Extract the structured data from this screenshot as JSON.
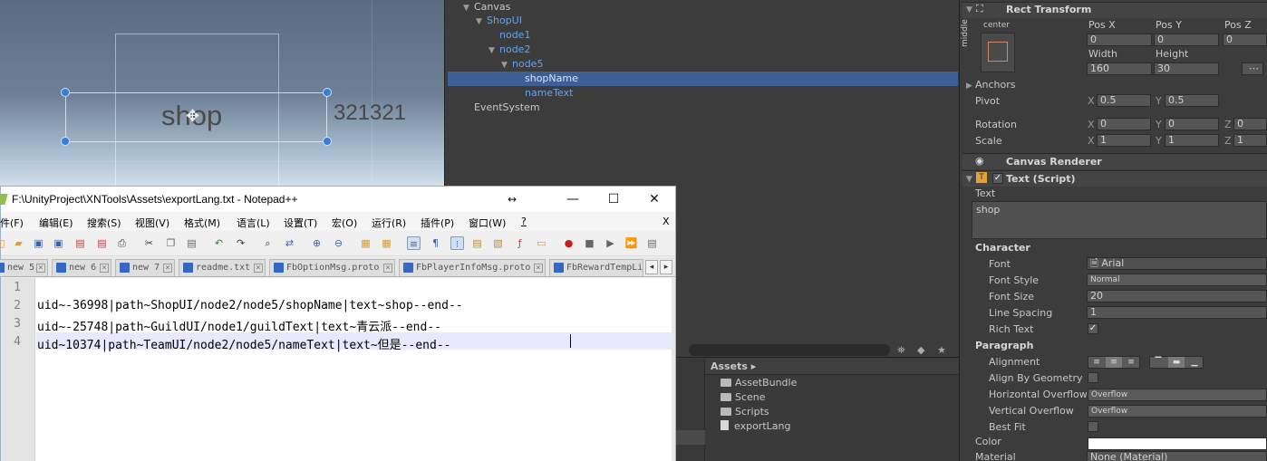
{
  "scene": {
    "shop_text": "shop",
    "number_text": "321321"
  },
  "hierarchy": {
    "items": [
      {
        "label": "Canvas",
        "expanded": true
      },
      {
        "label": "ShopUI",
        "expanded": true
      },
      {
        "label": "node1"
      },
      {
        "label": "node2",
        "expanded": true
      },
      {
        "label": "node5",
        "expanded": true
      },
      {
        "label": "shopName",
        "selected": true
      },
      {
        "label": "nameText"
      },
      {
        "label": "EventSystem"
      }
    ]
  },
  "project": {
    "header": "Assets ▸",
    "assets": [
      {
        "label": "AssetBundle",
        "type": "folder"
      },
      {
        "label": "Scene",
        "type": "folder"
      },
      {
        "label": "Scripts",
        "type": "folder"
      },
      {
        "label": "exportLang",
        "type": "file"
      }
    ]
  },
  "inspector": {
    "rect_transform": {
      "title": "Rect Transform",
      "anchor_h": "center",
      "anchor_v": "middle",
      "pos_x_label": "Pos X",
      "pos_y_label": "Pos Y",
      "pos_z_label": "Pos Z",
      "pos_x": "0",
      "pos_y": "0",
      "pos_z": "0",
      "width_label": "Width",
      "height_label": "Height",
      "width": "160",
      "height": "30",
      "anchors_label": "Anchors",
      "pivot_label": "Pivot",
      "pivot_x": "0.5",
      "pivot_y": "0.5",
      "rotation_label": "Rotation",
      "rot_x": "0",
      "rot_y": "0",
      "rot_z": "0",
      "scale_label": "Scale",
      "scale_x": "1",
      "scale_y": "1",
      "scale_z": "1",
      "x": "X",
      "y": "Y",
      "z": "Z"
    },
    "canvas_renderer": {
      "title": "Canvas Renderer"
    },
    "text_script": {
      "title": "Text (Script)",
      "text_label": "Text",
      "text_value": "shop",
      "character_label": "Character",
      "font_label": "Font",
      "font_value": "Arial",
      "font_style_label": "Font Style",
      "font_style_value": "Normal",
      "font_size_label": "Font Size",
      "font_size_value": "20",
      "line_spacing_label": "Line Spacing",
      "line_spacing_value": "1",
      "rich_text_label": "Rich Text",
      "rich_text_checked": true,
      "paragraph_label": "Paragraph",
      "alignment_label": "Alignment",
      "align_by_geometry_label": "Align By Geometry",
      "horizontal_overflow_label": "Horizontal Overflow",
      "horizontal_overflow_value": "Overflow",
      "vertical_overflow_label": "Vertical Overflow",
      "vertical_overflow_value": "Overflow",
      "best_fit_label": "Best Fit",
      "color_label": "Color",
      "color_value": "#ffffff",
      "material_label": "Material",
      "material_value": "None (Material)"
    }
  },
  "notepad": {
    "title": "F:\\UnityProject\\XNTools\\Assets\\exportLang.txt - Notepad++",
    "menu": [
      "文件(F)",
      "编辑(E)",
      "搜索(S)",
      "视图(V)",
      "格式(M)",
      "语言(L)",
      "设置(T)",
      "宏(O)",
      "运行(R)",
      "插件(P)",
      "窗口(W)",
      "?"
    ],
    "close_doc": "X",
    "tabs": [
      "new 5",
      "new 6",
      "new 7",
      "readme.txt",
      "FbOptionMsg.proto",
      "FbPlayerInfoMsg.proto",
      "FbRewardTempLi"
    ],
    "lines": [
      {
        "num": "1",
        "text": ""
      },
      {
        "num": "2",
        "text": "uid~-36998|path~ShopUI/node2/node5/shopName|text~shop--end--"
      },
      {
        "num": "3",
        "text": "uid~-25748|path~GuildUI/node1/guildText|text~青云派--end--"
      },
      {
        "num": "4",
        "text": "uid~10374|path~TeamUI/node2/node5/nameText|text~但是--end--"
      }
    ]
  }
}
